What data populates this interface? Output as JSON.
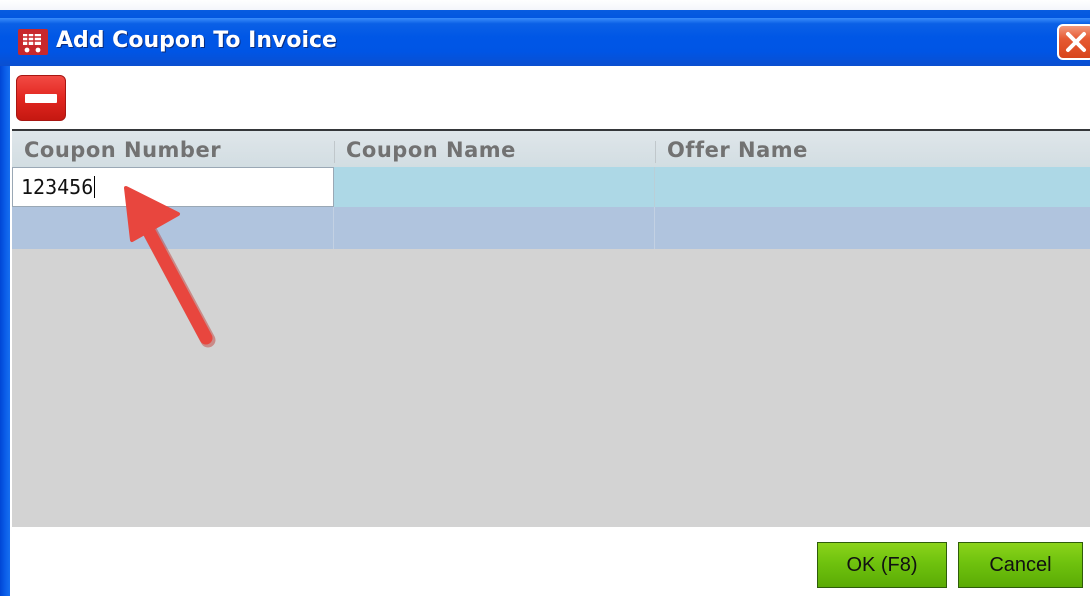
{
  "window": {
    "title": "Add Coupon To Invoice"
  },
  "icons": {
    "app": "shopping-cart-icon",
    "close": "close-icon",
    "remove": "minus-icon"
  },
  "grid": {
    "columns": [
      "Coupon Number",
      "Coupon Name",
      "Offer Name"
    ],
    "rows": [
      [
        "123456",
        "",
        ""
      ],
      [
        "",
        "",
        ""
      ]
    ]
  },
  "annotation": "red-arrow-pointing-at-coupon-input",
  "buttons": {
    "ok_label": "OK (F8)",
    "cancel_label": "Cancel"
  },
  "colors": {
    "title_bar": "#0055e5",
    "remove_button": "#e22720",
    "action_button": "#6fc20e",
    "row_selected": "#add8e6",
    "row_alt": "#b0c4de",
    "grid_empty": "#d3d3d3",
    "arrow": "#e8463e"
  }
}
